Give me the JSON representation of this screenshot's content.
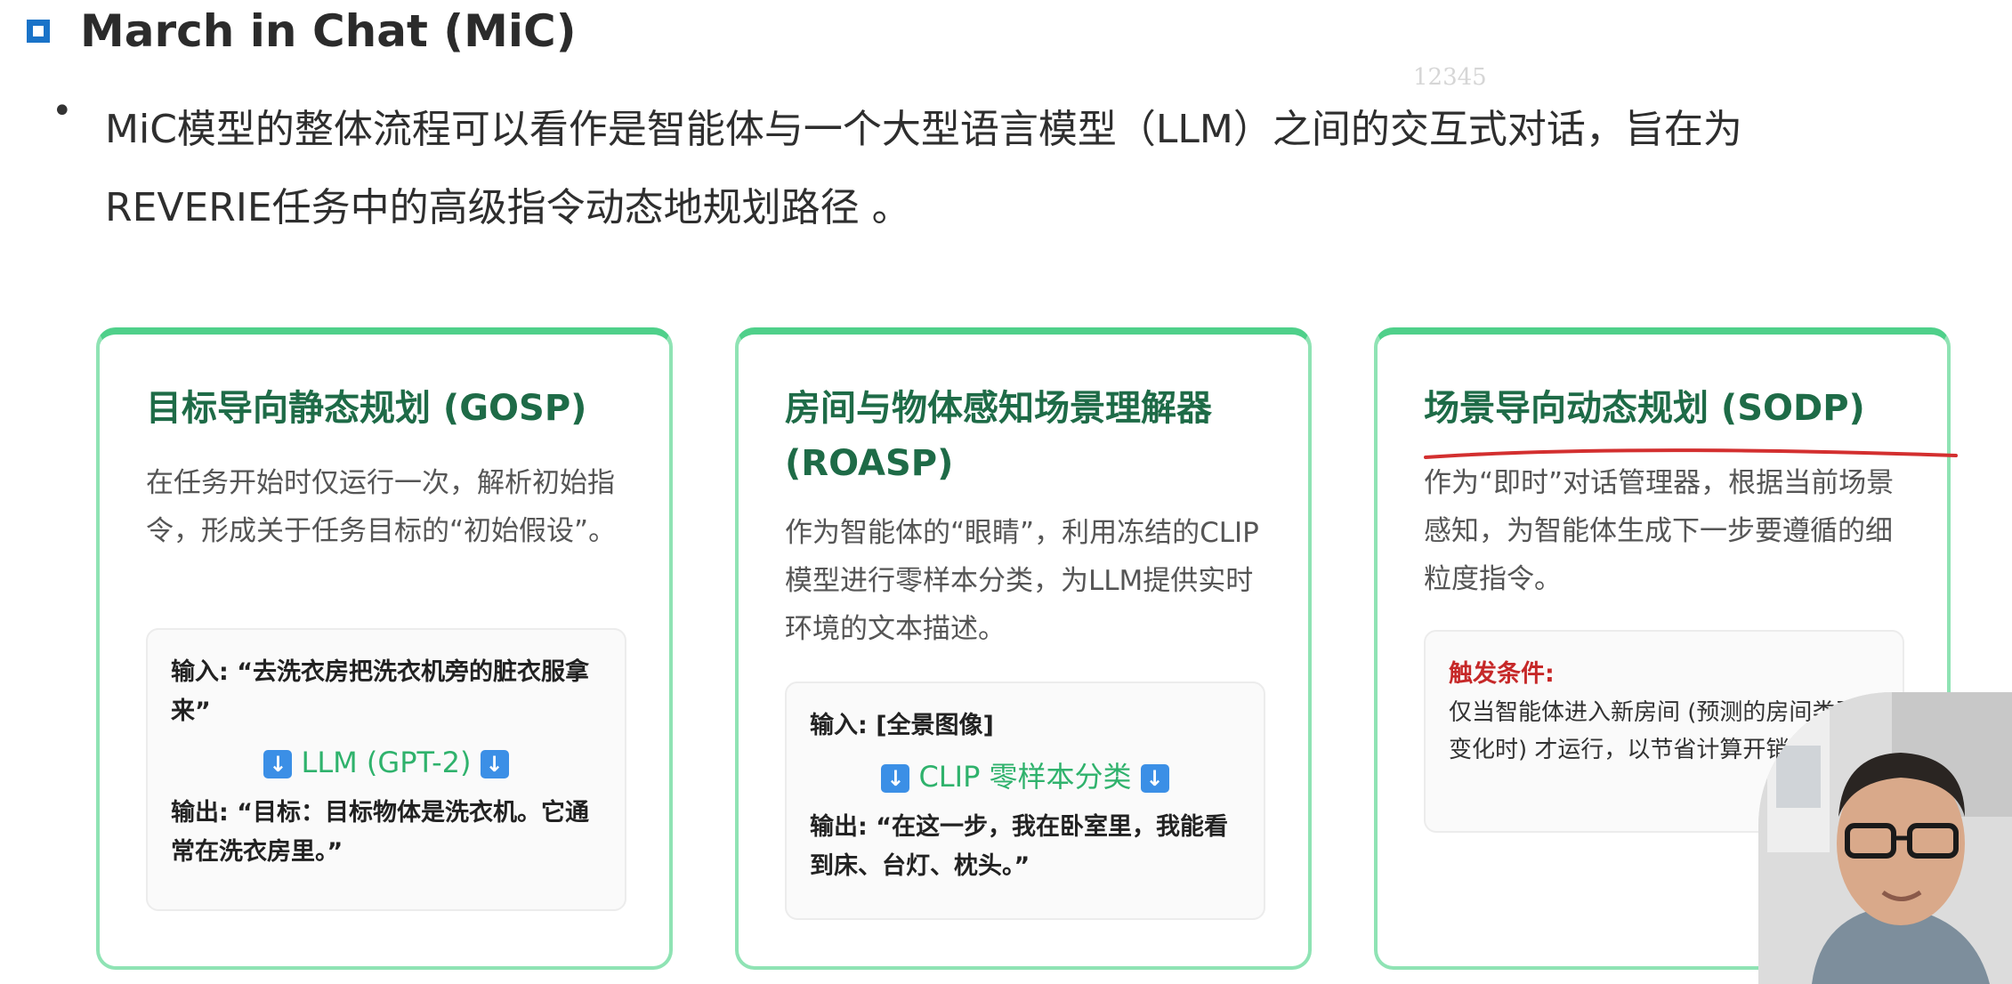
{
  "slide": {
    "title": "March in Chat (MiC)",
    "watermark": "12345",
    "bullet": "MiC模型的整体流程可以看作是智能体与一个大型语言模型（LLM）之间的交互式对话，旨在为REVERIE任务中的高级指令动态地规划路径 。"
  },
  "cards": [
    {
      "title": "目标导向静态规划 (GOSP)",
      "description": "在任务开始时仅运行一次，解析初始指令，形成关于任务目标的“初始假设”。",
      "input": "输入: “去洗衣房把洗衣机旁的脏衣服拿来”",
      "model": "LLM (GPT-2)",
      "output": "输出: “目标：目标物体是洗衣机。它通常在洗衣房里。”"
    },
    {
      "title": "房间与物体感知场景理解器 (ROASP)",
      "description": "作为智能体的“眼睛”，利用冻结的CLIP模型进行零样本分类，为LLM提供实时环境的文本描述。",
      "input": "输入: [全景图像]",
      "model": "CLIP 零样本分类",
      "output": "输出: “在这一步，我在卧室里，我能看到床、台灯、枕头。”"
    },
    {
      "title": "场景导向动态规划 (SODP)",
      "description": "作为“即时”对话管理器，根据当前场景感知，为智能体生成下一步要遵循的细粒度指令。",
      "trigger_label": "触发条件:",
      "trigger_text": "仅当智能体进入新房间 (预测的房间类型变化时) 才运行，以节省计算开销。"
    }
  ],
  "icons": {
    "title_marker": "square-icon",
    "flow_arrow": "down-arrow-icon"
  },
  "colors": {
    "accent_blue": "#1a73c8",
    "card_border": "#4fd08a",
    "card_title": "#1e6b47",
    "model_text": "#2fb26c",
    "trigger_red": "#c62828",
    "annotation_red": "#d32f2f"
  }
}
